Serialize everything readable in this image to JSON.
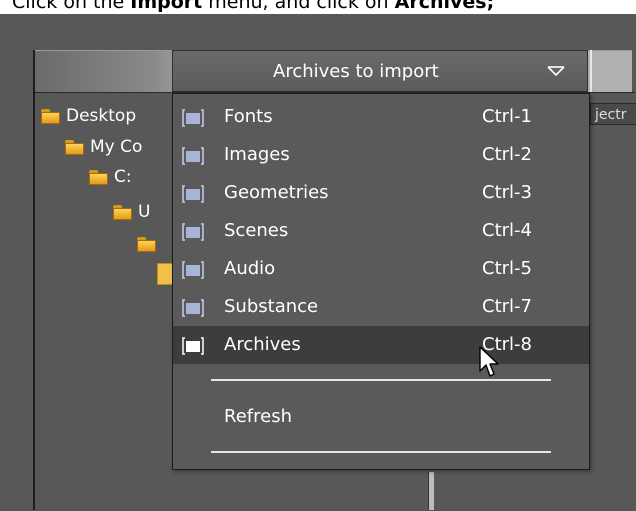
{
  "caption": {
    "part1": "Click on the ",
    "bold1": "Import",
    "part2": " menu, and click on ",
    "bold2": "Archives;"
  },
  "dropdown": {
    "label": "Archives to import"
  },
  "tree": {
    "items": [
      {
        "label": "Desktop"
      },
      {
        "label": "My Co"
      },
      {
        "label": "C:"
      },
      {
        "label": "U"
      },
      {
        "label": ""
      }
    ]
  },
  "side_tab": {
    "label": "jectr"
  },
  "menu": {
    "items": [
      {
        "label": "Fonts",
        "shortcut": "Ctrl-1",
        "checked": false
      },
      {
        "label": "Images",
        "shortcut": "Ctrl-2",
        "checked": false
      },
      {
        "label": "Geometries",
        "shortcut": "Ctrl-3",
        "checked": false
      },
      {
        "label": "Scenes",
        "shortcut": "Ctrl-4",
        "checked": false
      },
      {
        "label": "Audio",
        "shortcut": "Ctrl-5",
        "checked": false
      },
      {
        "label": "Substance",
        "shortcut": "Ctrl-7",
        "checked": false
      },
      {
        "label": "Archives",
        "shortcut": "Ctrl-8",
        "checked": true
      }
    ],
    "refresh_label": "Refresh",
    "highlighted_item": "Archives"
  },
  "colors": {
    "background": "#585858",
    "menu_bg": "#5a5a5a",
    "menu_highlight": "#3d3d3d",
    "checkbox_unchecked": "#a9b4d6",
    "checkbox_checked": "#ffffff",
    "folder": "#f2b535"
  },
  "icons": {
    "folder": "folder-icon",
    "dropdown": "chevron-down-icon",
    "checkbox": "checkbox-icon",
    "cursor": "mouse-pointer-icon"
  }
}
